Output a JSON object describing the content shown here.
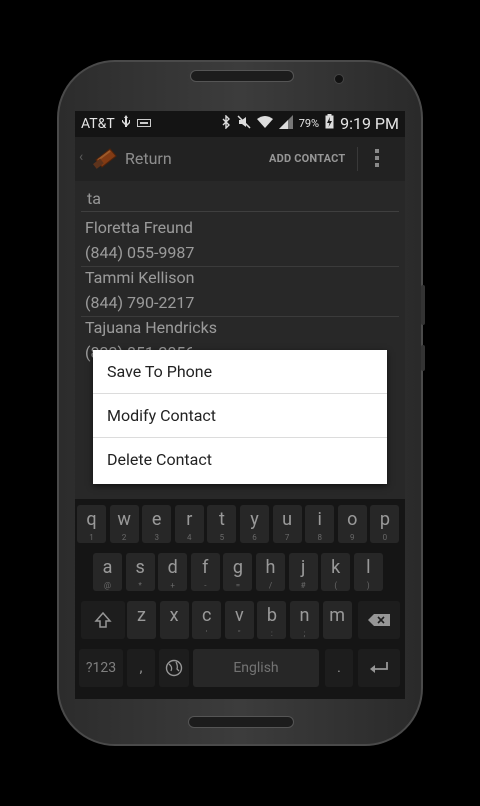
{
  "status": {
    "carrier": "AT&T",
    "battery_pct": "79%",
    "time": "9:19 PM"
  },
  "actionbar": {
    "title": "Return",
    "add_contact": "ADD CONTACT"
  },
  "search": {
    "value": "ta"
  },
  "contacts": [
    {
      "name": "Floretta Freund",
      "phone": "(844) 055-9987"
    },
    {
      "name": "Tammi Kellison",
      "phone": "(844) 790-2217"
    },
    {
      "name": "Tajuana Hendricks",
      "phone": "(833) 851-2056"
    }
  ],
  "context_menu": {
    "items": [
      "Save To Phone",
      "Modify Contact",
      "Delete Contact"
    ]
  },
  "keyboard": {
    "row1": [
      {
        "k": "q",
        "s": "1"
      },
      {
        "k": "w",
        "s": "2"
      },
      {
        "k": "e",
        "s": "3"
      },
      {
        "k": "r",
        "s": "4"
      },
      {
        "k": "t",
        "s": "5"
      },
      {
        "k": "y",
        "s": "6"
      },
      {
        "k": "u",
        "s": "7"
      },
      {
        "k": "i",
        "s": "8"
      },
      {
        "k": "o",
        "s": "9"
      },
      {
        "k": "p",
        "s": "0"
      }
    ],
    "row2": [
      {
        "k": "a",
        "s": "@"
      },
      {
        "k": "s",
        "s": "*"
      },
      {
        "k": "d",
        "s": "+"
      },
      {
        "k": "f",
        "s": "-"
      },
      {
        "k": "g",
        "s": "="
      },
      {
        "k": "h",
        "s": "/"
      },
      {
        "k": "j",
        "s": "#"
      },
      {
        "k": "k",
        "s": "("
      },
      {
        "k": "l",
        "s": ")"
      }
    ],
    "row3": [
      {
        "k": "z",
        "s": ""
      },
      {
        "k": "x",
        "s": ""
      },
      {
        "k": "c",
        "s": "'"
      },
      {
        "k": "v",
        "s": "\""
      },
      {
        "k": "b",
        "s": ":"
      },
      {
        "k": "n",
        "s": ";"
      },
      {
        "k": "m",
        "s": ""
      }
    ],
    "sym_label": "?123",
    "comma": ",",
    "space_label": "English",
    "period": "."
  }
}
